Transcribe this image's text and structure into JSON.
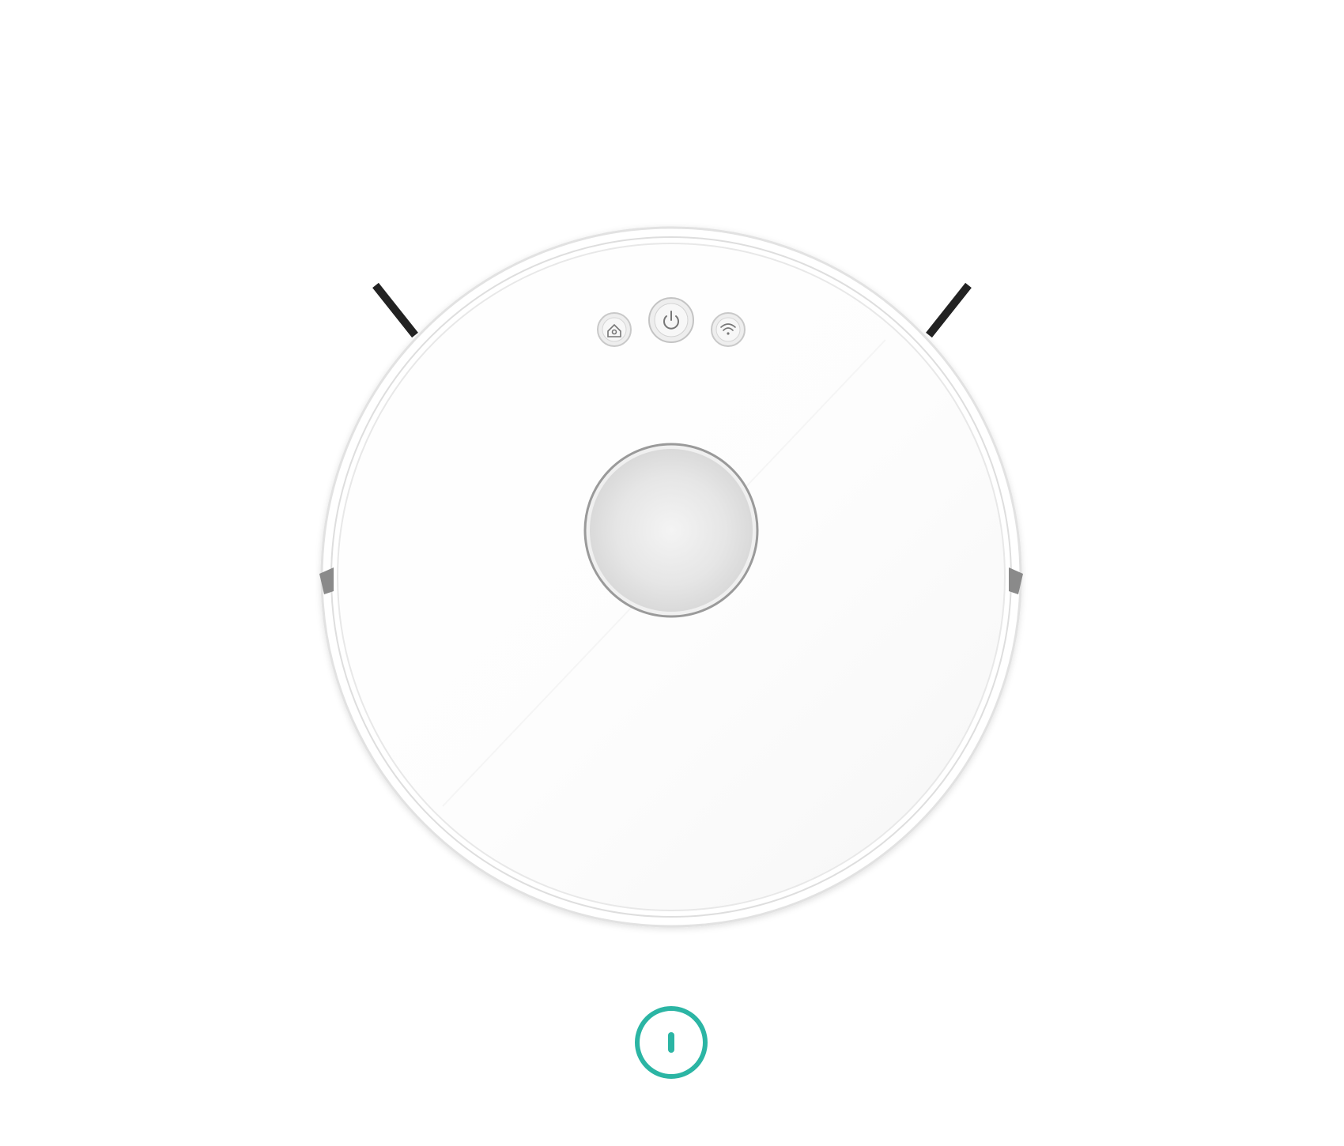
{
  "colors": {
    "background": "#ffffff",
    "accent": "#2bb5a4",
    "brush": "#222222",
    "bumper_tab": "#8a8a8a"
  },
  "robot": {
    "buttons": [
      {
        "name": "home-button",
        "icon": "home-icon"
      },
      {
        "name": "power-button",
        "icon": "power-icon"
      },
      {
        "name": "wifi-button",
        "icon": "wifi-icon"
      }
    ],
    "center_sensor": "lidar-cap"
  },
  "footer": {
    "action_button": {
      "icon": "power-toggle-icon",
      "color": "#2bb5a4"
    }
  }
}
